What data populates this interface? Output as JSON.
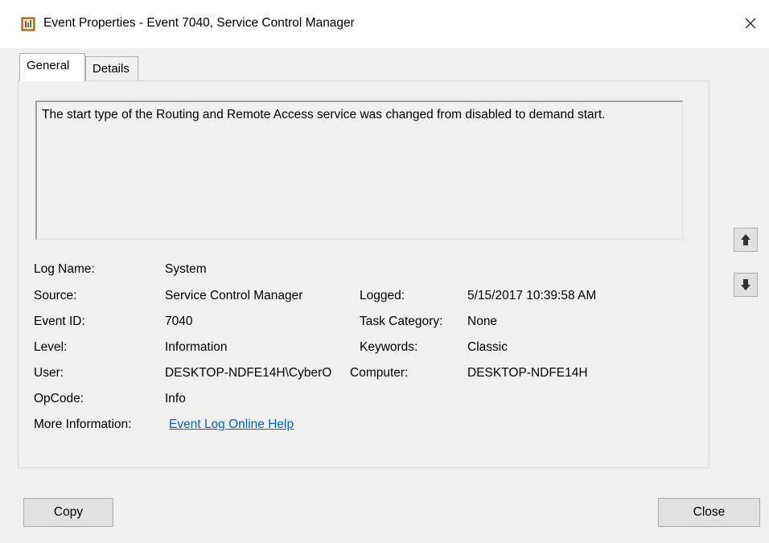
{
  "window": {
    "title": "Event Properties - Event 7040, Service Control Manager",
    "close_glyph": "×"
  },
  "tabs": [
    {
      "label": "General",
      "selected": true
    },
    {
      "label": "Details",
      "selected": false
    }
  ],
  "general": {
    "description": "The start type of the Routing and Remote Access service was changed from disabled to demand start.",
    "fields": {
      "log_name": {
        "label": "Log Name:",
        "value": "System"
      },
      "source": {
        "label": "Source:",
        "value": "Service Control Manager"
      },
      "logged": {
        "label": "Logged:",
        "value": "5/15/2017 10:39:58 AM"
      },
      "event_id": {
        "label": "Event ID:",
        "value": "7040"
      },
      "task_category": {
        "label": "Task Category:",
        "value": "None"
      },
      "level": {
        "label": "Level:",
        "value": "Information"
      },
      "keywords": {
        "label": "Keywords:",
        "value": "Classic"
      },
      "user": {
        "label": "User:",
        "value": "DESKTOP-NDFE14H\\CyberO"
      },
      "computer": {
        "label": "Computer:",
        "value": "DESKTOP-NDFE14H"
      },
      "opcode": {
        "label": "OpCode:",
        "value": "Info"
      },
      "more_info": {
        "label": "More Information:",
        "link_text": "Event Log Online Help"
      }
    }
  },
  "nav": {
    "up_icon": "arrow-up-icon",
    "down_icon": "arrow-down-icon"
  },
  "buttons": {
    "copy": "Copy",
    "close": "Close"
  },
  "colors": {
    "link": "#0066cc",
    "titlebar": "#ffffff",
    "dialog_bg": "#f0f0f0"
  }
}
